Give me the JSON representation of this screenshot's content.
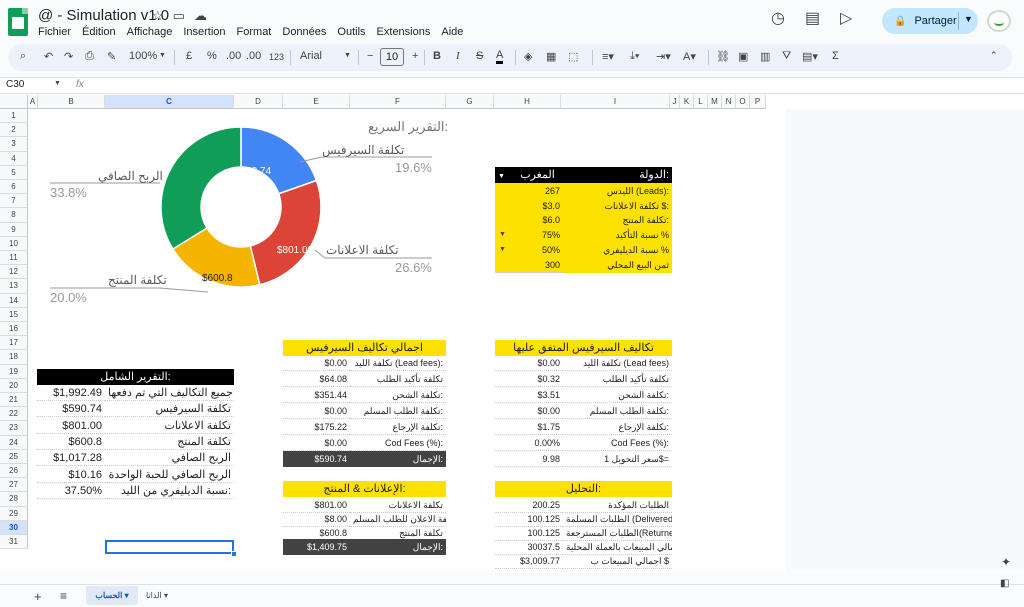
{
  "window": {
    "title": "@ - Simulation v1.0",
    "menu": [
      "Fichier",
      "Édition",
      "Affichage",
      "Insertion",
      "Format",
      "Données",
      "Outils",
      "Extensions",
      "Aide"
    ],
    "share_label": "Partager"
  },
  "toolbar": {
    "zoom": "100%",
    "currency": "£",
    "percent": "%",
    "decimals": ".00",
    "format_123": "123",
    "font": "Arial",
    "font_size": "10",
    "icons": [
      "search-icon",
      "undo-icon",
      "redo-icon",
      "print-icon",
      "paint-format-icon",
      "bold-icon",
      "italic-icon",
      "strikethrough-icon",
      "text-color-icon",
      "fill-color-icon",
      "borders-icon",
      "merge-icon",
      "align-icon",
      "valign-icon",
      "wrap-icon",
      "rotate-icon",
      "link-icon",
      "comment-icon",
      "chart-icon",
      "filter-icon",
      "filter-views-icon",
      "functions-icon"
    ]
  },
  "formula_bar": {
    "name_box": "C30",
    "fx": "fx"
  },
  "columns": [
    "A",
    "B",
    "C",
    "D",
    "E",
    "F",
    "G",
    "H",
    "I",
    "J",
    "K",
    "L",
    "M",
    "N",
    "O",
    "P"
  ],
  "rows": [
    "1",
    "2",
    "3",
    "4",
    "5",
    "6",
    "7",
    "8",
    "9",
    "10",
    "11",
    "12",
    "13",
    "14",
    "15",
    "16",
    "17",
    "18",
    "19",
    "20",
    "21",
    "22",
    "23",
    "24",
    "25",
    "26",
    "27",
    "28",
    "29",
    "30",
    "31"
  ],
  "chart_data": {
    "type": "pie",
    "title": "التقرير السريع:",
    "slices": [
      {
        "label": "تكلفة السيرفيس",
        "value": 590.74,
        "value_label": "$590.74",
        "percent": "19.6%",
        "color": "#4285f4"
      },
      {
        "label": "تكلفة الاعلانات",
        "value": 801.0,
        "value_label": "$801.00",
        "percent": "26.6%",
        "color": "#db4437"
      },
      {
        "label": "تكلفة المنتج",
        "value": 600.8,
        "value_label": "$600.8",
        "percent": "20.0%",
        "color": "#f4b400"
      },
      {
        "label": "الربح الصافي",
        "value": 1017.28,
        "value_label": "",
        "percent": "33.8%",
        "color": "#0f9d58"
      }
    ]
  },
  "country_table": {
    "header_label": "الدولة:",
    "header_value": "المغرب",
    "rows": [
      {
        "label": "الليدس (Leads):",
        "value": "267"
      },
      {
        "label": "تكلفة الاعلانات $:",
        "value": "$3.0"
      },
      {
        "label": "تكلفة المنتج:",
        "value": "$6.0"
      },
      {
        "label": "نسبة التأكيد %",
        "value": "75%"
      },
      {
        "label": "نسبة الديليفري %",
        "value": "50%"
      },
      {
        "label": "ثمن البيع المحلي",
        "value": "300"
      }
    ]
  },
  "overall_report": {
    "title": "التقرير الشامل:",
    "rows": [
      {
        "label": "جميع التكاليف التي تم دفعها:",
        "value": "$1,992.49"
      },
      {
        "label": "تكلفة السيرفيس",
        "value": "$590.74"
      },
      {
        "label": "تكلفة الاعلانات",
        "value": "$801.00"
      },
      {
        "label": "تكلفة المنتج",
        "value": "$600.8"
      },
      {
        "label": "الربح الصافي",
        "value": "$1,017.28"
      },
      {
        "label": "الربح الصافي للحبة الواحدة",
        "value": "$10.16"
      },
      {
        "label": "نسبة الديليفري من الليد:",
        "value": "37.50%"
      }
    ]
  },
  "service_total": {
    "title": "اجمالي تكاليف السيرفيس",
    "rows": [
      {
        "label": "تكلفة الليد (Lead fees):",
        "value": "$0.00"
      },
      {
        "label": "تكلفة تأكيد الطلب",
        "value": "$64.08"
      },
      {
        "label": "تكلفة الشحن:",
        "value": "$351.44"
      },
      {
        "label": "تكلفة الطلب المسلم:",
        "value": "$0.00"
      },
      {
        "label": "تكلفة الإرجاع:",
        "value": "$175.22"
      },
      {
        "label": "Cod Fees (%):",
        "value": "$0.00"
      }
    ],
    "total_label": "الإجمال:",
    "total_value": "$590.74"
  },
  "service_agreed": {
    "title": "تكاليف السيرفيس المتفق عليها",
    "rows": [
      {
        "label": "تكلفة الليد (Lead fees)",
        "value": "$0.00"
      },
      {
        "label": "تكلفة تأكيد الطلب",
        "value": "$0.32"
      },
      {
        "label": "تكلفة الشحن:",
        "value": "$3.51"
      },
      {
        "label": "تكلفة الطلب المسلم:",
        "value": "$0.00"
      },
      {
        "label": "تكلفة الإرجاع:",
        "value": "$1.75"
      },
      {
        "label": "Cod Fees (%):",
        "value": "0.00%"
      },
      {
        "label": "سعر التحويل 1$=",
        "value": "9.98"
      }
    ]
  },
  "ads_product": {
    "title": "الإعلانات & المنتج:",
    "rows": [
      {
        "label": "تكلفة الاعلانات",
        "value": "$801.00"
      },
      {
        "label": "تكلفة الاعلان للطلب المسلم",
        "value": "$8.00"
      },
      {
        "label": "تكلفة المنتج",
        "value": "$600.8"
      }
    ],
    "total_label": "الإجمال:",
    "total_value": "$1,409.75"
  },
  "analysis": {
    "title": "التحليل:",
    "rows": [
      {
        "label": "الطلبات المؤكدة",
        "value": "200.25"
      },
      {
        "label": "الطلبات المسلمة (Delivered)",
        "value": "100.125"
      },
      {
        "label": "الطلبات المسترجعة(Returned)",
        "value": "100.125"
      },
      {
        "label": "اجمالي المبيعات بالعملة المحلية",
        "value": "30037.5"
      },
      {
        "label": "اجمالي المبيعات ب $",
        "value": "$3,009.77"
      }
    ]
  },
  "sheets": [
    "الحساب",
    "الداتا"
  ]
}
